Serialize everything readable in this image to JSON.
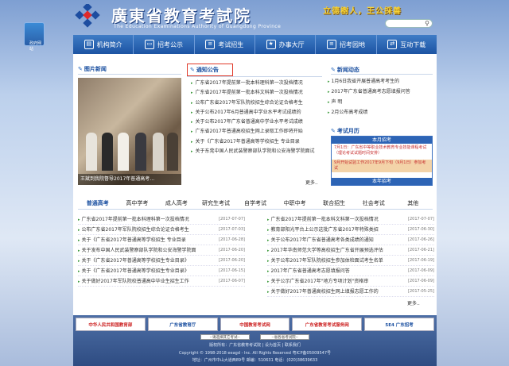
{
  "header": {
    "cn_title": "廣東省教育考試院",
    "en_title": "The Education Examinations Authority of Guangdong Province",
    "slogan": "立德樹人，王公採善"
  },
  "nav": [
    {
      "label": "机构简介",
      "icon": "building-icon"
    },
    {
      "label": "招考公示",
      "icon": "monitor-icon"
    },
    {
      "label": "考试招生",
      "icon": "document-icon"
    },
    {
      "label": "办事大厅",
      "icon": "star-icon"
    },
    {
      "label": "招考园地",
      "icon": "document-icon"
    },
    {
      "label": "互动下载",
      "icon": "arrows-icon"
    }
  ],
  "photo_news": {
    "title": "图片新闻",
    "caption": "王斌到我院督导2017年普通高考…"
  },
  "notices": {
    "title": "通知公告",
    "items": [
      "广东省2017年提前第一批本科理科第一次投档情况",
      "广东省2017年提前第一批本科文科第一次投档情况",
      "公布广东省2017年军队院校招生综合论证合格考生",
      "关于公布2017年6月普通高中学业水平考试成绩的",
      "关于公布2017年广东省普通高中学业水平考试成绩",
      "广东省2017年普通高校招生网上录取工作即将开始",
      "关于《广东省2017年普通高等学校招生 专业目录",
      "关于东莞中国人民武装警察部队学院和公安海警学院面试"
    ],
    "more": "更多.."
  },
  "news_dynamic": {
    "title": "新闻动态",
    "items": [
      "1月6日我省开展普通高考考生的",
      "2017年广东省普通高考志愿填报问答",
      "声 明",
      "2月公布高考成绩"
    ]
  },
  "exam_calendar": {
    "title": "考试月历",
    "header": "本月招考",
    "entry1": "7月1日：广东省中等职业技术教育专业技能课程考试（理论考试试题时间安排）",
    "entry2": "9月开始试验工作2017年9月下旬（9月1日）参加考试",
    "footer": "本年招考"
  },
  "tabs": [
    "普通高考",
    "高中学考",
    "成人高考",
    "研究生考试",
    "自学考试",
    "中职中考",
    "联合招生",
    "社会考试",
    "其他"
  ],
  "list_left": [
    {
      "t": "广东省2017年提前第一批本科理科第一次投档情况",
      "d": "[2017-07-07]"
    },
    {
      "t": "公布广东省2017年军队院校招生综合论证合格考生",
      "d": "[2017-07-03]"
    },
    {
      "t": "关于《广东省2017年普通高等学校招生 专业目录",
      "d": "[2017-06-28]"
    },
    {
      "t": "关于发布中国人民武装警察部队学院和公安海警学院面",
      "d": "[2017-06-20]"
    },
    {
      "t": "关于《广东省2017年普通高等学校招生专业目录》",
      "d": "[2017-06-20]"
    },
    {
      "t": "关于《广东省2017年普通高等学校招生专业目录》",
      "d": "[2017-06-15]"
    },
    {
      "t": "关于做好2017年军队院校普通高中毕业生招生工作",
      "d": "[2017-06-07]"
    }
  ],
  "list_right": [
    {
      "t": "广东省2017年提前第一批本科文科第一次投档情况",
      "d": "[2017-07-07]"
    },
    {
      "t": "教育部阳光平台上公示这批广东省2017年特殊类招",
      "d": "[2017-06-30]"
    },
    {
      "t": "关于公布2017年广东省普通高考各类成绩的通知",
      "d": "[2017-06-26]"
    },
    {
      "t": "2017年华南师范大学等高校招生广东省开展预选评估",
      "d": "[2017-06-21]"
    },
    {
      "t": "关于公布2017年军队院校招生参加体检面试考生名单",
      "d": "[2017-06-19]"
    },
    {
      "t": "2017年广东省普通高考志愿填报问答",
      "d": "[2017-06-09]"
    },
    {
      "t": "关于公示广东省2017年\"地方专项计划\"资格审",
      "d": "[2017-06-09]"
    },
    {
      "t": "关于做好2017年普通高校招生网上填报志愿工作的",
      "d": "[2017-05-25]"
    }
  ],
  "more2": "更多..",
  "links": [
    {
      "label": "中华人民共和国教育部",
      "cls": ""
    },
    {
      "label": "广东省教育厅",
      "cls": "b"
    },
    {
      "label": "中国教育考试网",
      "cls": ""
    },
    {
      "label": "广东省教育考试服务网",
      "cls": ""
    },
    {
      "label": "5E4 广东招考",
      "cls": "b"
    }
  ],
  "footer": {
    "sel1": "--请选择其它考试--",
    "sel2": "--省各省考试院--",
    "line1": "版权所有：广东省教育考试院 | 设为首页 | 联系我们",
    "line2": "Copyright © 1998-2018 eeagd - Inc. All Rights Reserved 粤ICP备05009547号",
    "line3": "地址：广州市中山大道西89号  邮编：510631  电话：(020)38639633",
    "badge": "政府网站"
  }
}
